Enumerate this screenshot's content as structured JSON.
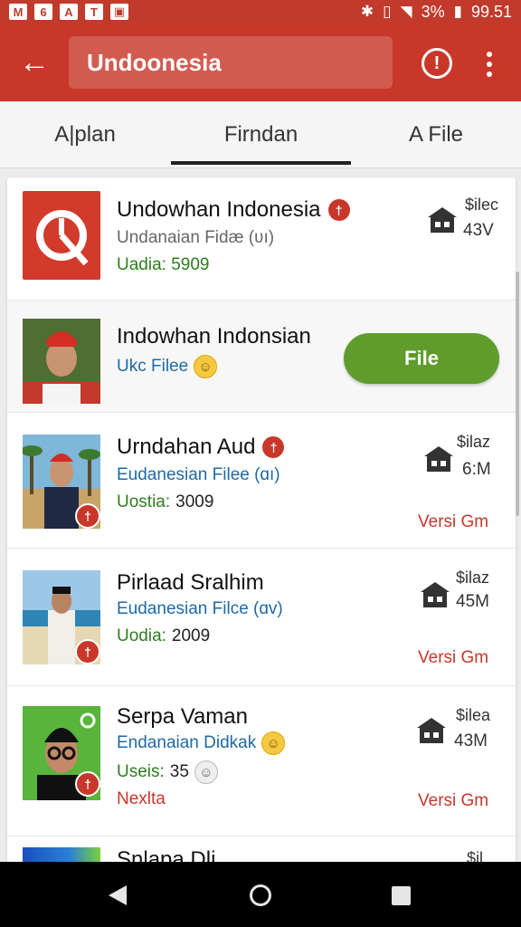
{
  "status_bar": {
    "left_icons": [
      "M",
      "6",
      "A",
      "T",
      "img"
    ],
    "right_icons": [
      "bluetooth-icon",
      "vibrate-icon",
      "wifi-icon"
    ],
    "battery": "3%",
    "time": "99.51"
  },
  "app_bar": {
    "title": "Undoonesia",
    "info_glyph": "!",
    "colors": {
      "bar": "#c9372a",
      "accent": "#c8372a",
      "button": "#5f9c2b"
    }
  },
  "tabs": [
    {
      "label": "A|plan"
    },
    {
      "label": "Firndan",
      "selected": true
    },
    {
      "label": "A File"
    }
  ],
  "items": [
    {
      "name": "Undowhan Indonesia",
      "subtitle": "Undanaian Fidæ (ʋı)",
      "meta_label": "Uadia: 5909",
      "meta_value": "",
      "size_label": "$ilec",
      "size_value": "43V",
      "icon": "logo-icon"
    },
    {
      "name": "Indowhan Indonsian",
      "subtitle": "Ukc Filee",
      "button_label": "File"
    },
    {
      "name": "Urndahan Aud",
      "subtitle": "Eudanesian Filee (ɑı)",
      "meta_label": "Uostia:",
      "meta_value": "3009",
      "size_label": "$ilaz",
      "size_value": "6:M",
      "version": "Versi Gm"
    },
    {
      "name": "Pirlaad Sralhim",
      "subtitle": "Eudanesian Filce (ɑv)",
      "meta_label": "Uodia:",
      "meta_value": "2009",
      "size_label": "$ilaz",
      "size_value": "45M",
      "version": "Versi Gm"
    },
    {
      "name": "Serpa Vaman",
      "subtitle": "Endanaian Didkak",
      "meta_label": "Useis:",
      "meta_value": "35",
      "extra": "Nexlta",
      "size_label": "$ilea",
      "size_value": "43M",
      "version": "Versi Gm"
    },
    {
      "name": "Snlapa Dli",
      "size_label": "$il"
    }
  ],
  "nav_bar": [
    "back-nav",
    "home-nav",
    "recent-apps-nav"
  ]
}
